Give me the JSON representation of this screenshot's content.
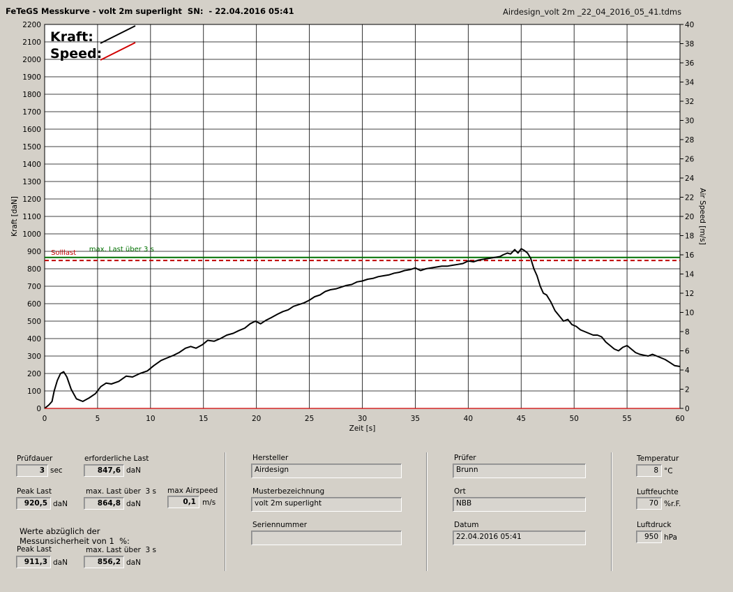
{
  "header": {
    "title": "FeTeGS Messkurve - volt 2m superlight  SN:  - 22.04.2016 05:41",
    "filename": "Airdesign_volt 2m _22_04_2016_05_41.tdms"
  },
  "chart_data": {
    "type": "line",
    "xlabel": "Zeit [s]",
    "ylabel": "Kraft [daN]",
    "y2label": "Air Speed [m/s]",
    "xlim": [
      0,
      60
    ],
    "ylim": [
      0,
      2200
    ],
    "y2lim": [
      0,
      40
    ],
    "xticks": [
      0,
      5,
      10,
      15,
      20,
      25,
      30,
      35,
      40,
      45,
      50,
      55,
      60
    ],
    "yticks": [
      0,
      100,
      200,
      300,
      400,
      500,
      600,
      700,
      800,
      900,
      1000,
      1100,
      1200,
      1300,
      1400,
      1500,
      1600,
      1700,
      1800,
      1900,
      2000,
      2100,
      2200
    ],
    "y2ticks": [
      0,
      2,
      4,
      6,
      8,
      10,
      12,
      14,
      16,
      18,
      20,
      22,
      24,
      26,
      28,
      30,
      32,
      34,
      36,
      38,
      40
    ],
    "grid": true,
    "legend_position": "top-left",
    "series": [
      {
        "name": "Kraft",
        "color": "#000000",
        "axis": "left",
        "x": [
          0,
          0.4,
          0.7,
          0.9,
          1.2,
          1.5,
          1.8,
          2.1,
          2.5,
          3.0,
          3.6,
          4.2,
          4.8,
          5.3,
          5.8,
          6.3,
          7.0,
          7.7,
          8.3,
          9.0,
          9.7,
          10.3,
          11.0,
          11.6,
          12.2,
          12.7,
          13.3,
          13.8,
          14.3,
          14.9,
          15.4,
          16.0,
          16.6,
          17.2,
          17.8,
          18.3,
          18.9,
          19.4,
          19.9,
          20.4,
          20.9,
          21.4,
          22.0,
          22.5,
          23.0,
          23.5,
          24.0,
          24.5,
          25.0,
          25.5,
          26.0,
          26.5,
          27.0,
          27.5,
          28.0,
          28.5,
          29.0,
          29.5,
          30.0,
          30.5,
          31.0,
          31.5,
          32.0,
          32.5,
          33.0,
          33.5,
          34.0,
          34.5,
          35.0,
          35.5,
          36.0,
          36.5,
          37.0,
          37.5,
          38.0,
          38.5,
          39.0,
          39.5,
          40.0,
          40.5,
          41.0,
          41.5,
          42.0,
          42.5,
          43.0,
          43.3,
          43.7,
          44.0,
          44.4,
          44.7,
          45.0,
          45.3,
          45.6,
          45.9,
          46.2,
          46.5,
          46.8,
          47.1,
          47.4,
          47.8,
          48.2,
          48.6,
          49.0,
          49.4,
          49.8,
          50.2,
          50.6,
          51.0,
          51.4,
          51.8,
          52.2,
          52.6,
          53.0,
          53.4,
          53.8,
          54.2,
          54.6,
          55.0,
          55.4,
          55.8,
          56.2,
          56.6,
          57.0,
          57.4,
          57.8,
          58.2,
          58.6,
          59.0,
          59.5,
          60.0
        ],
        "y": [
          0,
          20,
          40,
          100,
          160,
          200,
          210,
          180,
          110,
          55,
          40,
          60,
          85,
          125,
          145,
          140,
          155,
          185,
          180,
          200,
          215,
          245,
          275,
          290,
          305,
          320,
          345,
          355,
          345,
          365,
          390,
          385,
          400,
          420,
          430,
          445,
          460,
          485,
          500,
          485,
          505,
          520,
          540,
          555,
          565,
          585,
          595,
          605,
          620,
          640,
          650,
          670,
          680,
          685,
          695,
          705,
          710,
          725,
          730,
          740,
          745,
          755,
          760,
          765,
          775,
          780,
          790,
          795,
          805,
          790,
          800,
          805,
          810,
          815,
          815,
          820,
          825,
          830,
          845,
          840,
          850,
          855,
          860,
          865,
          870,
          880,
          890,
          885,
          910,
          890,
          915,
          905,
          890,
          860,
          800,
          760,
          700,
          660,
          650,
          610,
          560,
          530,
          500,
          510,
          480,
          470,
          450,
          440,
          430,
          420,
          420,
          410,
          380,
          360,
          340,
          330,
          350,
          360,
          340,
          320,
          310,
          305,
          300,
          310,
          300,
          290,
          280,
          265,
          245,
          240
        ]
      },
      {
        "name": "Speed",
        "color": "#d00000",
        "axis": "right",
        "x": [
          0,
          60
        ],
        "y": [
          0,
          0
        ]
      }
    ],
    "reference_lines": [
      {
        "label": "Solllast",
        "value": 847.6,
        "color": "#c00000",
        "style": "dashed"
      },
      {
        "label": "max. Last über  3 s",
        "value": 864.8,
        "color": "#007000",
        "style": "solid"
      }
    ]
  },
  "panel": {
    "pruefdauer_label": "Prüfdauer",
    "pruefdauer_value": "3",
    "pruefdauer_unit": "sec",
    "erf_last_label": "erforderliche Last",
    "erf_last_value": "847,6",
    "erf_last_unit": "daN",
    "peak_label": "Peak Last",
    "peak_value": "920,5",
    "peak_unit": "daN",
    "maxlast_label": "max. Last über  3 s",
    "maxlast_value": "864,8",
    "maxlast_unit": "daN",
    "airspeed_label": "max Airspeed",
    "airspeed_value": "0,1",
    "airspeed_unit": "m/s",
    "werte_line1": "Werte abzüglich der",
    "werte_line2": "Messunsicherheit von 1  %:",
    "peak2_label": "Peak Last",
    "peak2_value": "911,3",
    "peak2_unit": "daN",
    "maxlast2_label": "max. Last über  3 s",
    "maxlast2_value": "856,2",
    "maxlast2_unit": "daN",
    "hersteller_label": "Hersteller",
    "hersteller_value": "Airdesign",
    "muster_label": "Musterbezeichnung",
    "muster_value": "volt 2m superlight",
    "serien_label": "Seriennummer",
    "serien_value": "",
    "pruefer_label": "Prüfer",
    "pruefer_value": "Brunn",
    "ort_label": "Ort",
    "ort_value": "NBB",
    "datum_label": "Datum",
    "datum_value": "22.04.2016 05:41",
    "temp_label": "Temperatur",
    "temp_value": "8",
    "temp_unit": "°C",
    "feuchte_label": "Luftfeuchte",
    "feuchte_value": "70",
    "feuchte_unit": "%r.F.",
    "druck_label": "Luftdruck",
    "druck_value": "950",
    "druck_unit": "hPa"
  }
}
